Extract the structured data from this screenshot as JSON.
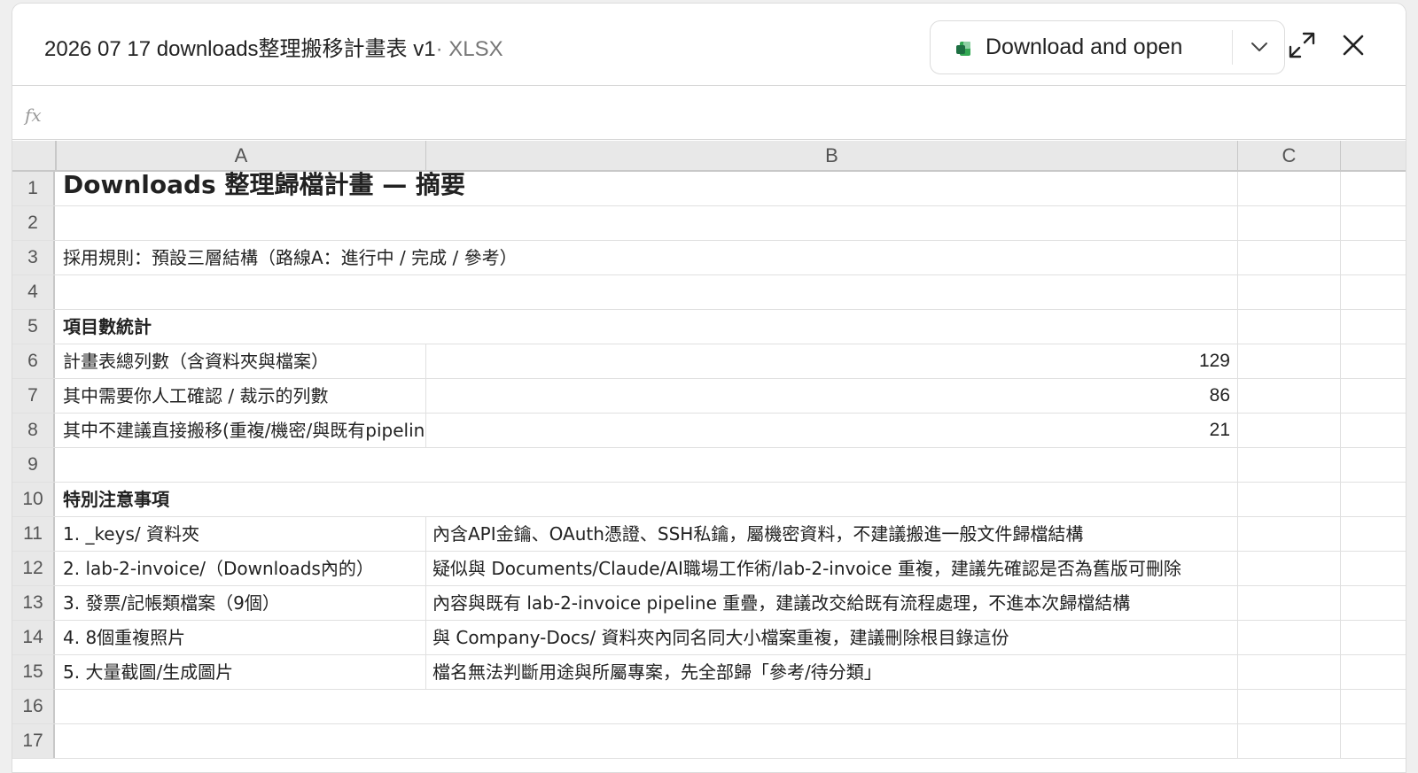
{
  "header": {
    "title": "2026 07 17 downloads整理搬移計畫表 v1",
    "file_type": "· XLSX",
    "download_label": "Download and open"
  },
  "formula_bar": {
    "fx": "fx",
    "value": ""
  },
  "grid": {
    "columns": [
      "A",
      "B",
      "C"
    ],
    "rows": [
      {
        "n": "1",
        "a": "Downloads 整理歸檔計畫 — 摘要",
        "b": ""
      },
      {
        "n": "2",
        "a": "",
        "b": ""
      },
      {
        "n": "3",
        "a": "採用規則：預設三層結構（路線A：進行中 / 完成 / 參考）",
        "b": ""
      },
      {
        "n": "4",
        "a": "",
        "b": ""
      },
      {
        "n": "5",
        "a": "項目數統計",
        "b": ""
      },
      {
        "n": "6",
        "a": "計畫表總列數（含資料夾與檔案）",
        "b": "129"
      },
      {
        "n": "7",
        "a": "其中需要你人工確認 / 裁示的列數",
        "b": "86"
      },
      {
        "n": "8",
        "a": "其中不建議直接搬移(重複/機密/與既有pipeline",
        "b": "21"
      },
      {
        "n": "9",
        "a": "",
        "b": ""
      },
      {
        "n": "10",
        "a": "特別注意事項",
        "b": ""
      },
      {
        "n": "11",
        "a": "1. _keys/ 資料夾",
        "b": "內含API金鑰、OAuth憑證、SSH私鑰，屬機密資料，不建議搬進一般文件歸檔結構"
      },
      {
        "n": "12",
        "a": "2. lab-2-invoice/（Downloads內的）",
        "b": "疑似與 Documents/Claude/AI職場工作術/lab-2-invoice 重複，建議先確認是否為舊版可刪除"
      },
      {
        "n": "13",
        "a": "3. 發票/記帳類檔案（9個）",
        "b": "內容與既有 lab-2-invoice pipeline 重疊，建議改交給既有流程處理，不進本次歸檔結構"
      },
      {
        "n": "14",
        "a": "4. 8個重複照片",
        "b": "與 Company-Docs/ 資料夾內同名同大小檔案重複，建議刪除根目錄這份"
      },
      {
        "n": "15",
        "a": "5. 大量截圖/生成圖片",
        "b": "檔名無法判斷用途與所屬專案，先全部歸「參考/待分類」"
      },
      {
        "n": "16",
        "a": "",
        "b": ""
      },
      {
        "n": "17",
        "a": "",
        "b": ""
      }
    ]
  },
  "colors": {
    "excel_green": "#1d6f42",
    "header_bg": "#e8e8e8"
  },
  "icons": {
    "file": "excel-file-icon",
    "chevron": "chevron-down-icon",
    "expand": "expand-icon",
    "close": "close-icon"
  }
}
